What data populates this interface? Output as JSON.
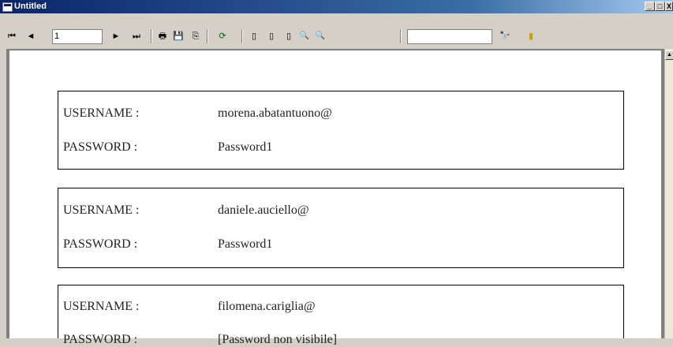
{
  "window": {
    "title": "Untitled",
    "btn_min": "_",
    "btn_max": "□",
    "btn_close": "X"
  },
  "toolbar": {
    "first_icon": "⏮",
    "prev_icon": "◄",
    "page_value": "1",
    "next_icon": "►",
    "last_icon": "⏭",
    "print_icon": "🖶",
    "save_icon": "💾",
    "export_icon": "⎘",
    "refresh_icon": "⟳",
    "page1_icon": "▯",
    "page2_icon": "▯",
    "page3_icon": "▯",
    "zoom_out_icon": "🔍",
    "zoom_in_icon": "🔍",
    "search_value": "",
    "find_icon": "🔭",
    "exit_icon": "▮"
  },
  "cards": [
    {
      "user_label": "USERNAME :",
      "user_value": "morena.abatantuono@",
      "pass_label": "PASSWORD :",
      "pass_value": "Password1"
    },
    {
      "user_label": "USERNAME :",
      "user_value": "daniele.auciello@",
      "pass_label": "PASSWORD :",
      "pass_value": "Password1"
    },
    {
      "user_label": "USERNAME :",
      "user_value": "filomena.cariglia@",
      "pass_label": "PASSWORD :",
      "pass_value": "[Password non visibile]"
    }
  ],
  "colors": {
    "titlebar": "#0a246a",
    "chrome": "#d4d0c8",
    "viewer": "#808080"
  }
}
